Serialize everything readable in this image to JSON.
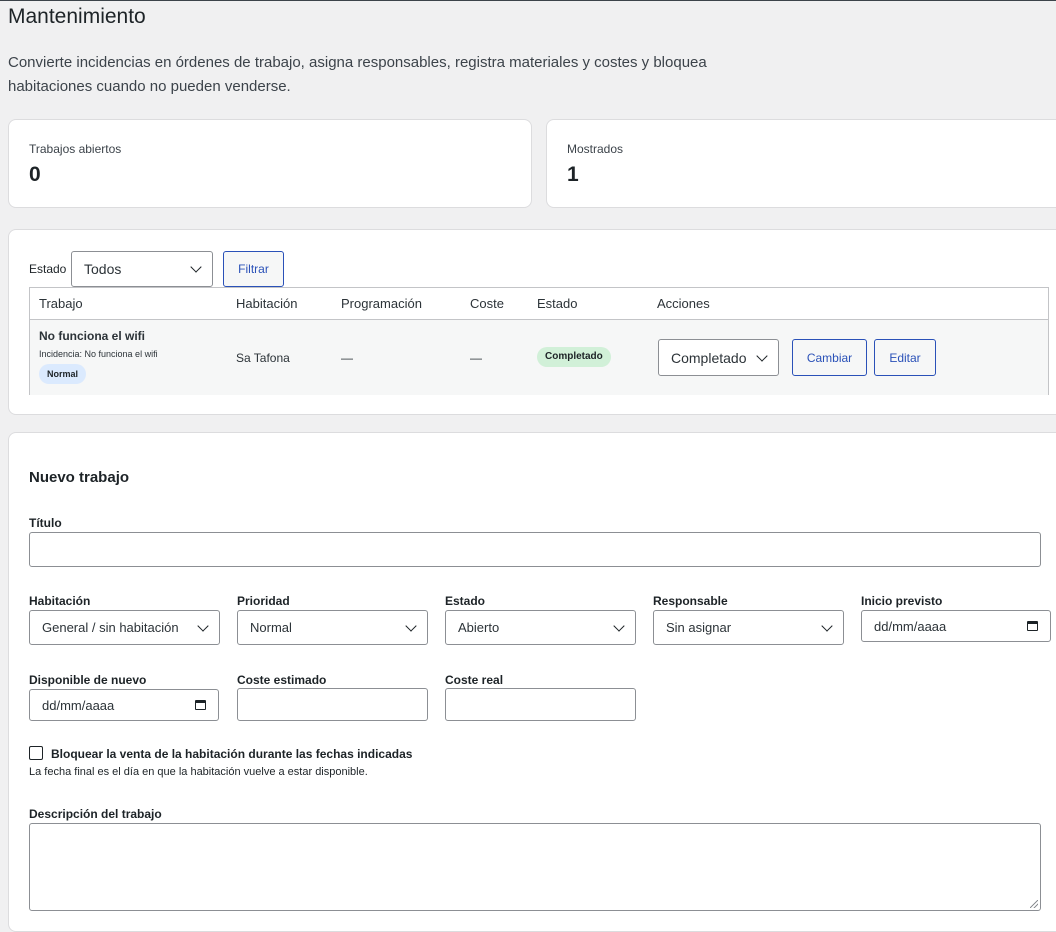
{
  "page": {
    "title": "Mantenimiento",
    "description": "Convierte incidencias en órdenes de trabajo, asigna responsables, registra materiales y costes y bloquea habitaciones cuando no pueden venderse."
  },
  "stats": [
    {
      "label": "Trabajos abiertos",
      "value": "0"
    },
    {
      "label": "Mostrados",
      "value": "1"
    }
  ],
  "filter": {
    "estado_label": "Estado",
    "estado_value": "Todos",
    "filter_button": "Filtrar"
  },
  "table": {
    "columns": [
      "Trabajo",
      "Habitación",
      "Programación",
      "Coste",
      "Estado",
      "Acciones"
    ],
    "rows": [
      {
        "title": "No funciona el wifi",
        "incident": "Incidencia: No funciona el wifi",
        "priority": "Normal",
        "room": "Sa Tafona",
        "schedule": "—",
        "cost": "—",
        "status": "Completado",
        "action_select": "Completado",
        "change_button": "Cambiar",
        "edit_button": "Editar"
      }
    ]
  },
  "form": {
    "title": "Nuevo trabajo",
    "titulo_label": "Título",
    "titulo_value": "",
    "habitacion_label": "Habitación",
    "habitacion_value": "General / sin habitación",
    "prioridad_label": "Prioridad",
    "prioridad_value": "Normal",
    "estado_label": "Estado",
    "estado_value": "Abierto",
    "responsable_label": "Responsable",
    "responsable_value": "Sin asignar",
    "inicio_label": "Inicio previsto",
    "inicio_placeholder": "dd/mm/aaaa",
    "disponible_label": "Disponible de nuevo",
    "disponible_placeholder": "dd/mm/aaaa",
    "coste_estimado_label": "Coste estimado",
    "coste_real_label": "Coste real",
    "bloquear_label": "Bloquear la venta de la habitación durante las fechas indicadas",
    "bloquear_help": "La fecha final es el día en que la habitación vuelve a estar disponible.",
    "descripcion_label": "Descripción del trabajo"
  },
  "colors": {
    "accent": "#2a51b8",
    "badge_normal_bg": "#dbeafe",
    "badge_completed_bg": "#d1f0d8"
  }
}
